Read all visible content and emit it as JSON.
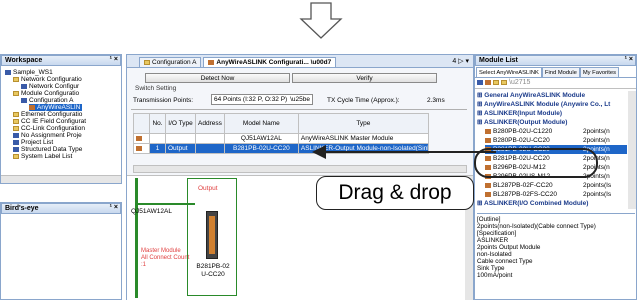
{
  "workspace": {
    "title": "Workspace",
    "controls": "¹ ×",
    "items": [
      "Sample_WS1",
      "Network Configuratio",
      "Network Configur",
      "Module Configuratio",
      "Configuration A",
      "AnyWireASLIN",
      "Ethernet Configuratio",
      "CC IE Field Configurat",
      "CC-Link Configuration",
      "No Assignment Proje",
      "Project List",
      "Structured Data Type",
      "System Label List"
    ]
  },
  "birdseye": {
    "title": "Bird's-eye",
    "controls": "¹ ×"
  },
  "editor": {
    "tabs": [
      "Configuration A",
      "AnyWireASLINK Configurati..."
    ],
    "tab_controls": "4 ▷ ▾",
    "buttons": {
      "detect": "Detect Now",
      "verify": "Verify"
    },
    "switch_setting": "Switch Setting",
    "trans_label": "Transmission Points:",
    "trans_value": "64 Points (I:32 P, O:32 P)",
    "cycle_label": "TX Cycle Time (Approx.):",
    "cycle_value": "2.3ms",
    "headers": [
      "No.",
      "I/O Type",
      "Address",
      "Model Name",
      "Type"
    ],
    "rows": [
      {
        "no": "",
        "io": "",
        "addr": "",
        "model": "QJ51AW12AL",
        "type": "AnyWireASLINK Master Module"
      },
      {
        "no": "1",
        "io": "Output",
        "addr": "",
        "model": "B281PB-02U-CC20",
        "type": "ASLINKER-Output Module-non-Isolated(Sink Type"
      }
    ],
    "canvas": {
      "master_label": "QJ51AW12AL",
      "master_text": "Master Module\nAll Connect Count\n:1",
      "output_label": "Output",
      "unit_label": "B281PB-02\nU-CC20"
    }
  },
  "module_list": {
    "title": "Module List",
    "controls": "¹ ×",
    "tabs": [
      "Select AnyWireASLINK",
      "Find Module",
      "My Favorites"
    ],
    "items": [
      {
        "text": "General AnyWireASLINK Module",
        "kind": "cat"
      },
      {
        "text": "AnyWireASLINK Module (Anywire Co., Lt",
        "kind": "cat"
      },
      {
        "text": "ASLINKER(Input Module)",
        "kind": "cat"
      },
      {
        "text": "ASLINKER(Output Module)",
        "kind": "cat"
      },
      {
        "text": "B280PB-02U-C1220",
        "pts": "2points(n",
        "kind": "item"
      },
      {
        "text": "B280PB-02U-CC20",
        "pts": "2points(n",
        "kind": "item"
      },
      {
        "text": "B281PB-02U-CC20",
        "pts": "2points(n",
        "kind": "sel"
      },
      {
        "text": "B281PB-02U-CC20",
        "pts": "2points(n",
        "kind": "item"
      },
      {
        "text": "B296PB-02U-M12",
        "pts": "2points(n",
        "kind": "item"
      },
      {
        "text": "B296PB-02US-M12",
        "pts": "2points(n",
        "kind": "item"
      },
      {
        "text": "BL287PB-02F-CC20",
        "pts": "2points(Is",
        "kind": "item"
      },
      {
        "text": "BL287PB-02FS-CC20",
        "pts": "2points(Is",
        "kind": "item"
      },
      {
        "text": "ASLINKER(I/O Combined Module)",
        "kind": "cat"
      }
    ],
    "desc": [
      "[Outline]",
      "2points(non-Isolated)(Cable connect Type)",
      "[Specification]",
      "ASLINKER",
      "2points Output Module",
      "non-Isolated",
      "Cable connect Type",
      "Sink Type",
      "100mA/point"
    ]
  },
  "callout": "Drag & drop",
  "colors": {
    "accent": "#1f5fbf",
    "highlight": "#1e66c8",
    "red": "#e04040"
  }
}
